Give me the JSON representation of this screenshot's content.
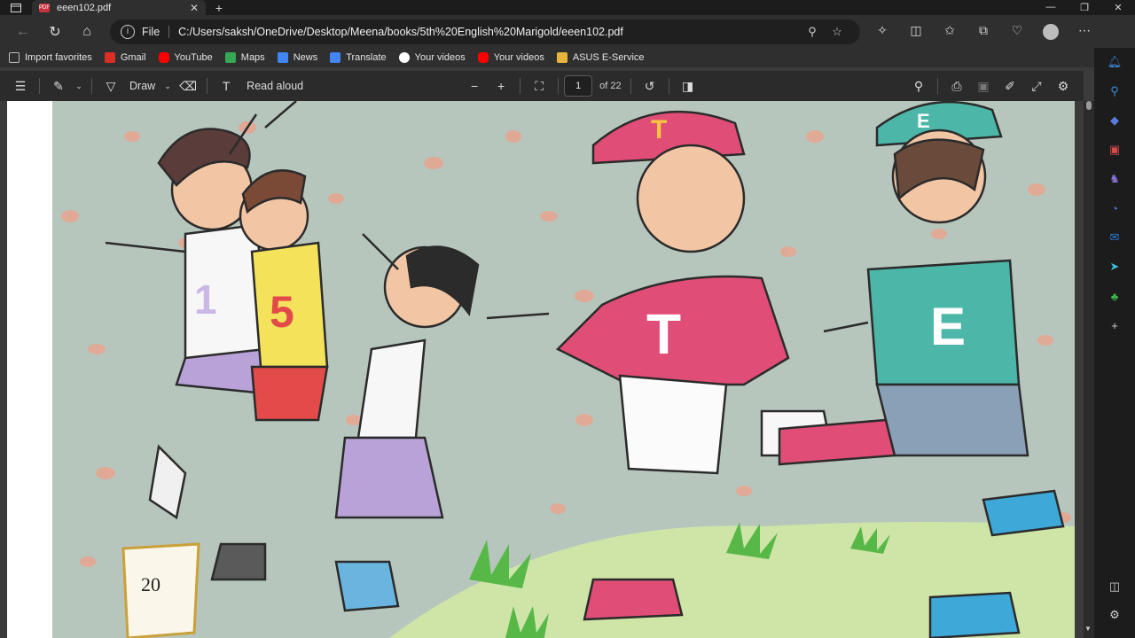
{
  "tab": {
    "title": "eeen102.pdf",
    "close": "✕",
    "new_tab": "+"
  },
  "window": {
    "minimize": "—",
    "maximize": "❐",
    "close": "✕"
  },
  "address": {
    "scheme": "File",
    "url": "C:/Users/saksh/OneDrive/Desktop/Meena/books/5th%20English%20Marigold/eeen102.pdf"
  },
  "bookmarks": [
    {
      "label": "Import favorites",
      "icon": "import-icon",
      "color": "#bdbdbd"
    },
    {
      "label": "Gmail",
      "icon": "gmail-icon",
      "color": "#d93025"
    },
    {
      "label": "YouTube",
      "icon": "youtube-icon",
      "color": "#ff0000"
    },
    {
      "label": "Maps",
      "icon": "maps-icon",
      "color": "#34a853"
    },
    {
      "label": "News",
      "icon": "news-icon",
      "color": "#4285f4"
    },
    {
      "label": "Translate",
      "icon": "translate-icon",
      "color": "#4285f4"
    },
    {
      "label": "Your videos",
      "icon": "google-icon",
      "color": "#ea4335"
    },
    {
      "label": "Your videos",
      "icon": "youtube-icon",
      "color": "#ff0000"
    },
    {
      "label": "ASUS E-Service",
      "icon": "folder-icon",
      "color": "#e8b53c"
    }
  ],
  "pdf_toolbar": {
    "draw": "Draw",
    "read_aloud": "Read aloud",
    "page_current": "1",
    "page_total": "of 22"
  },
  "page": {
    "page_number": "20",
    "shirt_letters": [
      "1",
      "5",
      "T",
      "E"
    ],
    "cap_letters": [
      "T",
      "E"
    ]
  },
  "colors": {
    "accent": "#3c8ad8",
    "page_background": "#b7c6bd"
  }
}
